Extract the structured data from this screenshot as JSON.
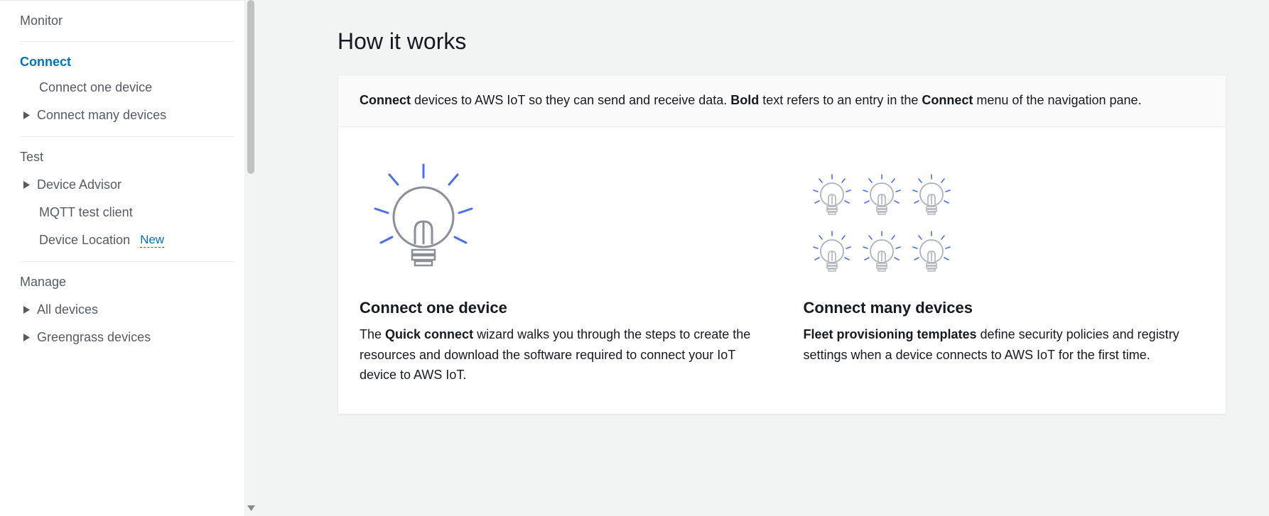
{
  "sidebar": {
    "monitor": "Monitor",
    "connect": {
      "heading": "Connect",
      "one": "Connect one device",
      "many": "Connect many devices"
    },
    "test": {
      "heading": "Test",
      "advisor": "Device Advisor",
      "mqtt": "MQTT test client",
      "location": "Device Location",
      "location_badge": "New"
    },
    "manage": {
      "heading": "Manage",
      "all": "All devices",
      "greengrass": "Greengrass devices"
    }
  },
  "main": {
    "title": "How it works",
    "intro_parts": {
      "connect_bold": "Connect",
      "mid1": " devices to AWS IoT so they can send and receive data. ",
      "bold_word": "Bold",
      "mid2": " text refers to an entry in the ",
      "connect_bold2": "Connect",
      "tail": " menu of the navigation pane."
    },
    "cards": {
      "one": {
        "title": "Connect one device",
        "p_pre": "The ",
        "p_bold": "Quick connect",
        "p_post": " wizard walks you through the steps to create the resources and download the software required to connect your IoT device to AWS IoT."
      },
      "many": {
        "title": "Connect many devices",
        "p_bold": "Fleet provisioning templates",
        "p_post": " define security policies and registry settings when a device connects to AWS IoT for the first time."
      }
    }
  }
}
